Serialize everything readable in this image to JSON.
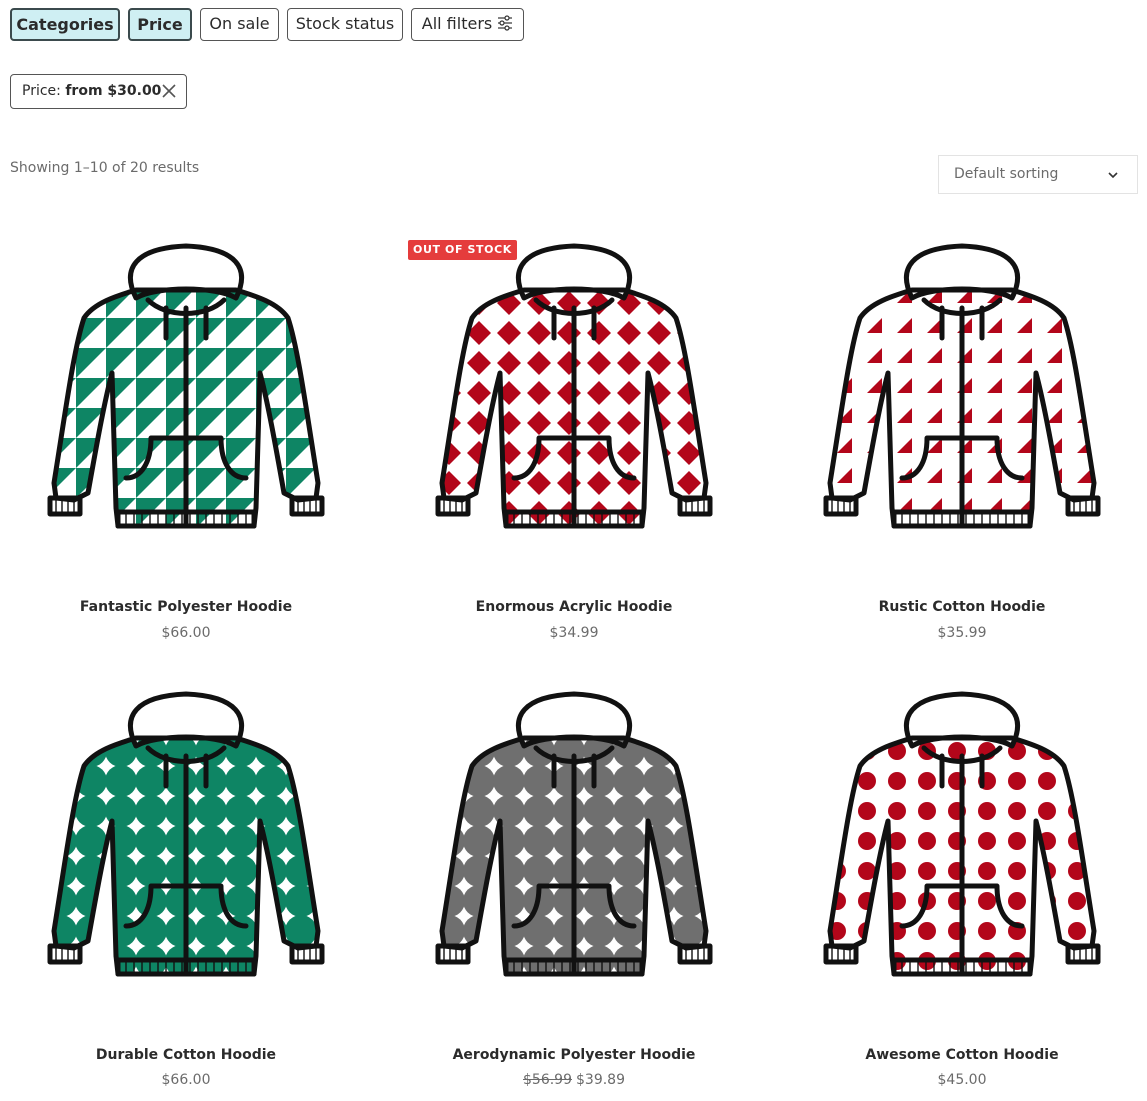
{
  "filters": {
    "chips": [
      {
        "label": "Categories",
        "active": true
      },
      {
        "label": "Price",
        "active": true
      },
      {
        "label": "On sale",
        "active": false
      },
      {
        "label": "Stock status",
        "active": false
      },
      {
        "label": "All filters",
        "active": false,
        "icon": "sliders-icon"
      }
    ],
    "active_filter": {
      "prefix": "Price:",
      "value": "from $30.00",
      "remove_icon": "close-icon"
    }
  },
  "results": {
    "count_text": "Showing 1–10 of 20 results"
  },
  "sorting": {
    "selected": "Default sorting",
    "icon": "chevron-down-icon"
  },
  "colors": {
    "accent_bg": "#cfeff3",
    "badge": "#e53c3c",
    "green": "#0e8564",
    "green_dark": "#2a6f5d",
    "red": "#b3061a",
    "pink": "#d9707a",
    "pale_pink": "#fcd5d9",
    "gray": "#6f6f6f",
    "light_gray": "#e2e2e2"
  },
  "products": [
    {
      "name": "Fantastic Polyester Hoodie",
      "price": "$66.00",
      "image_icon": "hoodie-green-geometric-icon"
    },
    {
      "name": "Enormous Acrylic Hoodie",
      "price": "$34.99",
      "badge": "OUT OF STOCK",
      "image_icon": "hoodie-red-diamond-icon"
    },
    {
      "name": "Rustic Cotton Hoodie",
      "price": "$35.99",
      "image_icon": "hoodie-red-pinwheel-icon"
    },
    {
      "name": "Durable Cotton Hoodie",
      "price": "$66.00",
      "image_icon": "hoodie-green-dots-icon"
    },
    {
      "name": "Aerodynamic Polyester Hoodie",
      "regular_price": "$56.99",
      "price": "$39.89",
      "image_icon": "hoodie-gray-dots-icon"
    },
    {
      "name": "Awesome Cotton Hoodie",
      "price": "$45.00",
      "image_icon": "hoodie-red-stars-icon"
    }
  ]
}
